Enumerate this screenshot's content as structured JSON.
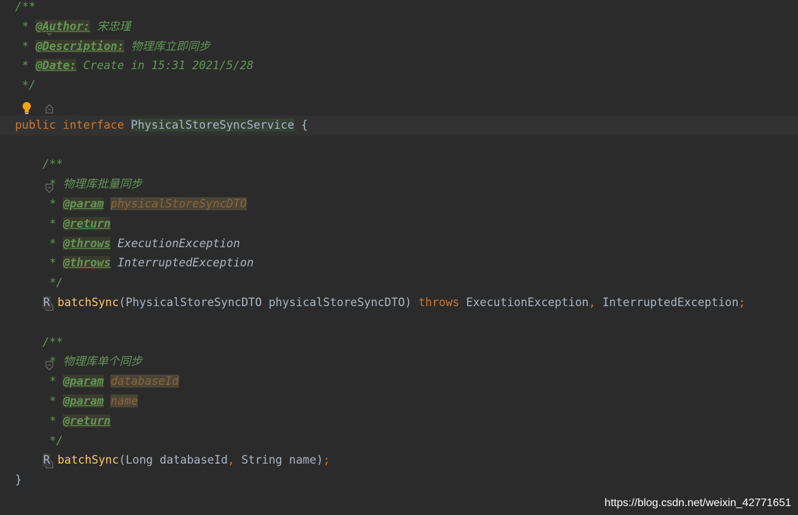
{
  "editor": {
    "javadoc_open": "/**",
    "javadoc_star": "*",
    "javadoc_close": "*/",
    "class_doc": {
      "author_tag": "@Author:",
      "author_value": "宋忠瑾",
      "description_tag": "@Description:",
      "description_value": "物理库立即同步",
      "date_tag": "@Date:",
      "date_value": "Create in 15:31 2021/5/28"
    },
    "declaration": {
      "kw_public": "public",
      "kw_interface": "interface",
      "name": "PhysicalStoreSyncService",
      "brace_open": "{",
      "brace_close": "}"
    },
    "method1_doc": {
      "summary": "物理库批量同步",
      "param_tag": "@param",
      "param_value": "physicalStoreSyncDTO",
      "return_tag": "@return",
      "throws_tag": "@throws",
      "throws_value1": "ExecutionException",
      "throws_value2": "InterruptedException"
    },
    "method1": {
      "return_type": "R",
      "name": "batchSync",
      "params": "(PhysicalStoreSyncDTO physicalStoreSyncDTO)",
      "kw_throws": "throws",
      "exception1": "ExecutionException",
      "comma": ",",
      "exception2": "InterruptedException",
      "semicolon": ";"
    },
    "method2_doc": {
      "summary": "物理库单个同步",
      "param_tag": "@param",
      "param_value1": "databaseId",
      "param_value2": "name",
      "return_tag": "@return"
    },
    "method2": {
      "return_type": "R",
      "name": "batchSync",
      "params_a": "(Long databaseId",
      "comma": ",",
      "params_b": "String name)",
      "semicolon": ";"
    }
  },
  "watermark": "https://blog.csdn.net/weixin_42771651",
  "colors": {
    "background": "#2b2b2b",
    "keyword": "#cc7832",
    "doc_comment": "#629755",
    "method": "#ffc66d",
    "text": "#a9b7c6",
    "bulb": "#f0a30a"
  },
  "icons": [
    "fold-icon",
    "lightbulb-icon"
  ]
}
